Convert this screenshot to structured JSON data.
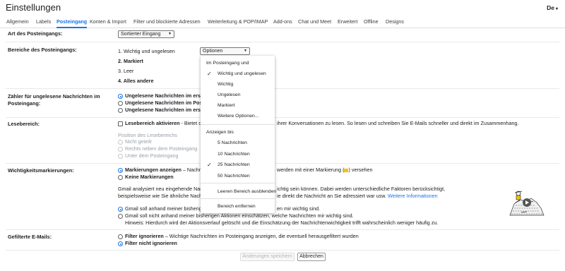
{
  "header": {
    "title": "Einstellungen",
    "language": "De"
  },
  "tabs": [
    {
      "label": "Allgemein",
      "active": false
    },
    {
      "label": "Labels",
      "active": false
    },
    {
      "label": "Posteingang",
      "active": true
    },
    {
      "label": "Konten & Import",
      "active": false
    },
    {
      "label": "Filter und blockierte Adressen",
      "active": false
    },
    {
      "label": "Weiterleitung & POP/IMAP",
      "active": false
    },
    {
      "label": "Add-ons",
      "active": false
    },
    {
      "label": "Chat und Meet",
      "active": false
    },
    {
      "label": "Erweitert",
      "active": false
    },
    {
      "label": "Offline",
      "active": false
    },
    {
      "label": "Designs",
      "active": false
    }
  ],
  "inbox_type": {
    "label": "Art des Posteingangs:",
    "value": "Sortierter Eingang"
  },
  "sections": {
    "label": "Bereiche des Posteingangs:",
    "items": [
      "1. Wichtig und ungelesen",
      "2. Markiert",
      "3. Leer",
      "4. Alles andere"
    ],
    "options_button": "Optionen"
  },
  "counter": {
    "label": "Zähler für ungelesene Nachrichten im Posteingang:",
    "options": [
      "Ungelesene Nachrichten im ersten",
      "Ungelesene Nachrichten im Postei",
      "Ungelesene Nachrichten im ersten"
    ]
  },
  "reading_pane": {
    "label": "Lesebereich:",
    "checkbox": "Lesebereich aktivieren",
    "checkbox_suffix": "- Bietet die",
    "description_tail": "ihrer Konversationen zu lesen. So lesen und schreiben Sie E-Mails schneller und direkt im Zusammenhang.",
    "position_label": "Position des Lesebereichs",
    "positions": [
      "Nicht geteilt",
      "Rechts neben dem Posteingang",
      "Unter dem Posteingang"
    ]
  },
  "importance": {
    "label": "Wichtigkeitsmarkierungen:",
    "show_label": "Markierungen anzeigen",
    "show_suffix": "– Nachrich",
    "show_tail": "werden mit einer Markierung (",
    "show_tail_end": ") versehen",
    "hide_label": "Keine Markierungen",
    "analysis_line1_a": "Gmail analysiert neu eingehende Nachrich",
    "analysis_line1_b": "ichtig sein können. Dabei werden unterschiedliche Faktoren berücksichtigt,",
    "analysis_line2_a": "beispielsweise wie Sie ähnliche Nachrich",
    "analysis_line2_b": "ie direkt die Nachricht an Sie adressiert war usw.",
    "more_info": "Weitere Informationen",
    "opt1_a": "Gmail soll anhand meiner bisherige",
    "opt1_b": "en mir wichtig sind.",
    "opt2": "Gmail soll nicht anhand meiner bisherigen Aktionen einschätzen, welche Nachrichten mir wichtig sind.",
    "note": "Hinweis: Hierdurch wird der Aktionsverlauf gelöscht und die Einschätzung der Nachrichtenwichtigkeit trifft wahrscheinlich weniger häufig zu."
  },
  "filtered": {
    "label": "Gefilterte E-Mails:",
    "option1": "Filter ignorieren",
    "option1_desc": "– Wichtige Nachrichten im Posteingang anzeigen, die eventuell herausgefiltert wurden",
    "option2": "Filter nicht ignorieren"
  },
  "footer": {
    "save": "Änderungen speichern",
    "cancel": "Abbrechen"
  },
  "menu": {
    "heading1": "Im Posteingang und",
    "filters": [
      {
        "label": "Wichtig und ungelesen",
        "checked": true
      },
      {
        "label": "Wichtig",
        "checked": false
      },
      {
        "label": "Ungelesen",
        "checked": false
      },
      {
        "label": "Markiert",
        "checked": false
      },
      {
        "label": "Weitere Optionen...",
        "checked": false
      }
    ],
    "heading2": "Anzeigen bis",
    "counts": [
      {
        "label": "5 Nachrichten",
        "checked": false
      },
      {
        "label": "10 Nachrichten",
        "checked": false
      },
      {
        "label": "25 Nachrichten",
        "checked": true
      },
      {
        "label": "50 Nachrichten",
        "checked": false
      }
    ],
    "hide_empty": "Leeren Bereich ausblenden",
    "remove": "Bereich entfernen"
  },
  "colors": {
    "accent": "#1a73e8",
    "importance_marker": "#f4c20d"
  }
}
